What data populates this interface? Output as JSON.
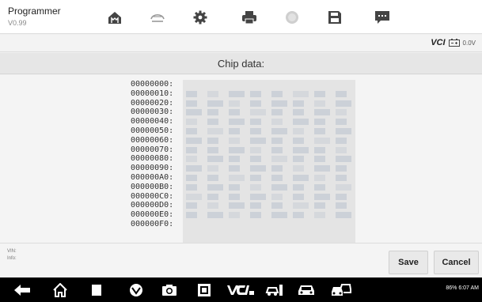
{
  "app": {
    "title": "Programmer",
    "version": "V0.99"
  },
  "toolbar": [
    {
      "icon": "home-icon"
    },
    {
      "icon": "vehicle-swap-icon"
    },
    {
      "icon": "gear-icon"
    },
    {
      "icon": "print-icon"
    },
    {
      "icon": "help-icon"
    },
    {
      "icon": "save-icon"
    },
    {
      "icon": "chat-icon"
    }
  ],
  "vci": {
    "label": "VCI",
    "voltage": "0.0V"
  },
  "section": {
    "title": "Chip data:"
  },
  "addresses": [
    "00000000:",
    "00000010:",
    "00000020:",
    "00000030:",
    "00000040:",
    "00000050:",
    "00000060:",
    "00000070:",
    "00000080:",
    "00000090:",
    "000000A0:",
    "000000B0:",
    "000000C0:",
    "000000D0:",
    "000000E0:",
    "000000F0:"
  ],
  "footer": {
    "vin_label": "VIN:",
    "info_label": "Info:",
    "save_label": "Save",
    "cancel_label": "Cancel"
  },
  "navbar": {
    "icons": [
      "back-icon",
      "home-icon",
      "recent-apps-icon",
      "browser-icon",
      "camera-icon",
      "screenshot-icon",
      "vci-icon",
      "vehicle-maintenance-icon",
      "car-icon",
      "multi-vehicle-icon"
    ],
    "status": "86% 6:07 AM"
  },
  "colors": {
    "background": "#f0f0f0",
    "navbar": "#000000",
    "pixelated": "#c9ced6"
  }
}
